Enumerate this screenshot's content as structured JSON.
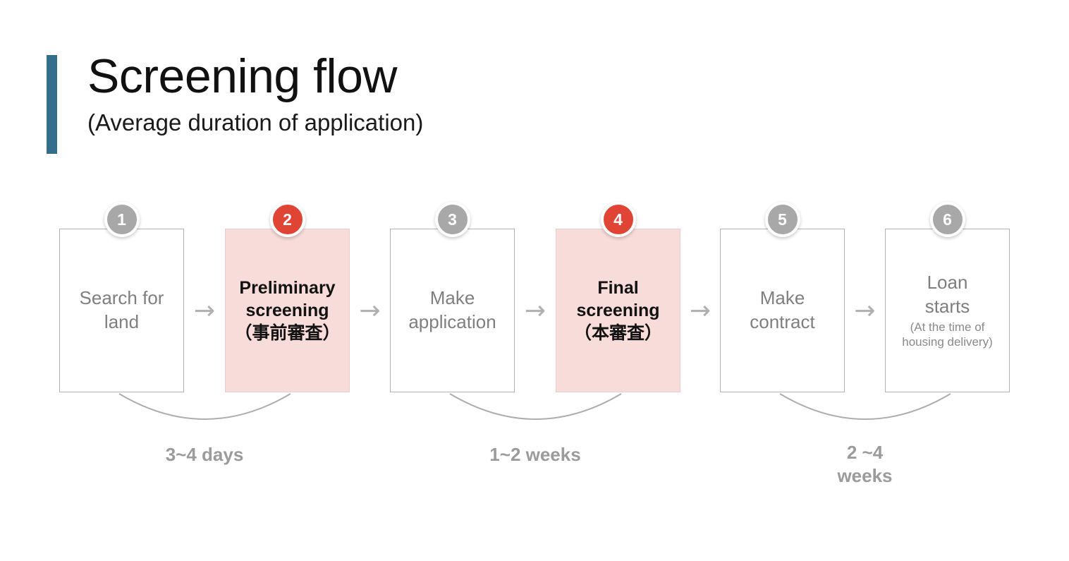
{
  "header": {
    "title": "Screening flow",
    "subtitle": "(Average duration of application)",
    "accent_color": "#336f8c"
  },
  "colors": {
    "highlight_fill": "#f8dcd9",
    "badge_gray": "#a8a8a8",
    "badge_red": "#df4434",
    "box_border": "#b3b3b3",
    "muted_text": "#7f7f7f",
    "duration_text": "#9b9b9b"
  },
  "flow": {
    "arrow_icon": "→",
    "steps": [
      {
        "number": "1",
        "label": "Search for\nland",
        "sub": "",
        "highlight": false,
        "badge_color": "gray"
      },
      {
        "number": "2",
        "label": "Preliminary\nscreening\n（事前審査）",
        "sub": "",
        "highlight": true,
        "badge_color": "red"
      },
      {
        "number": "3",
        "label": "Make\napplication",
        "sub": "",
        "highlight": false,
        "badge_color": "gray"
      },
      {
        "number": "4",
        "label": "Final\nscreening\n（本審査）",
        "sub": "",
        "highlight": true,
        "badge_color": "red"
      },
      {
        "number": "5",
        "label": "Make\ncontract",
        "sub": "",
        "highlight": false,
        "badge_color": "gray"
      },
      {
        "number": "6",
        "label": "Loan\nstarts",
        "sub": "(At the time of\nhousing delivery)",
        "highlight": false,
        "badge_color": "gray"
      }
    ],
    "durations": [
      {
        "text": "3~4 days",
        "spans_steps": "1-2"
      },
      {
        "text": "1~2 weeks",
        "spans_steps": "3-4"
      },
      {
        "text": "2 ~4\nweeks",
        "spans_steps": "5-6"
      }
    ]
  }
}
